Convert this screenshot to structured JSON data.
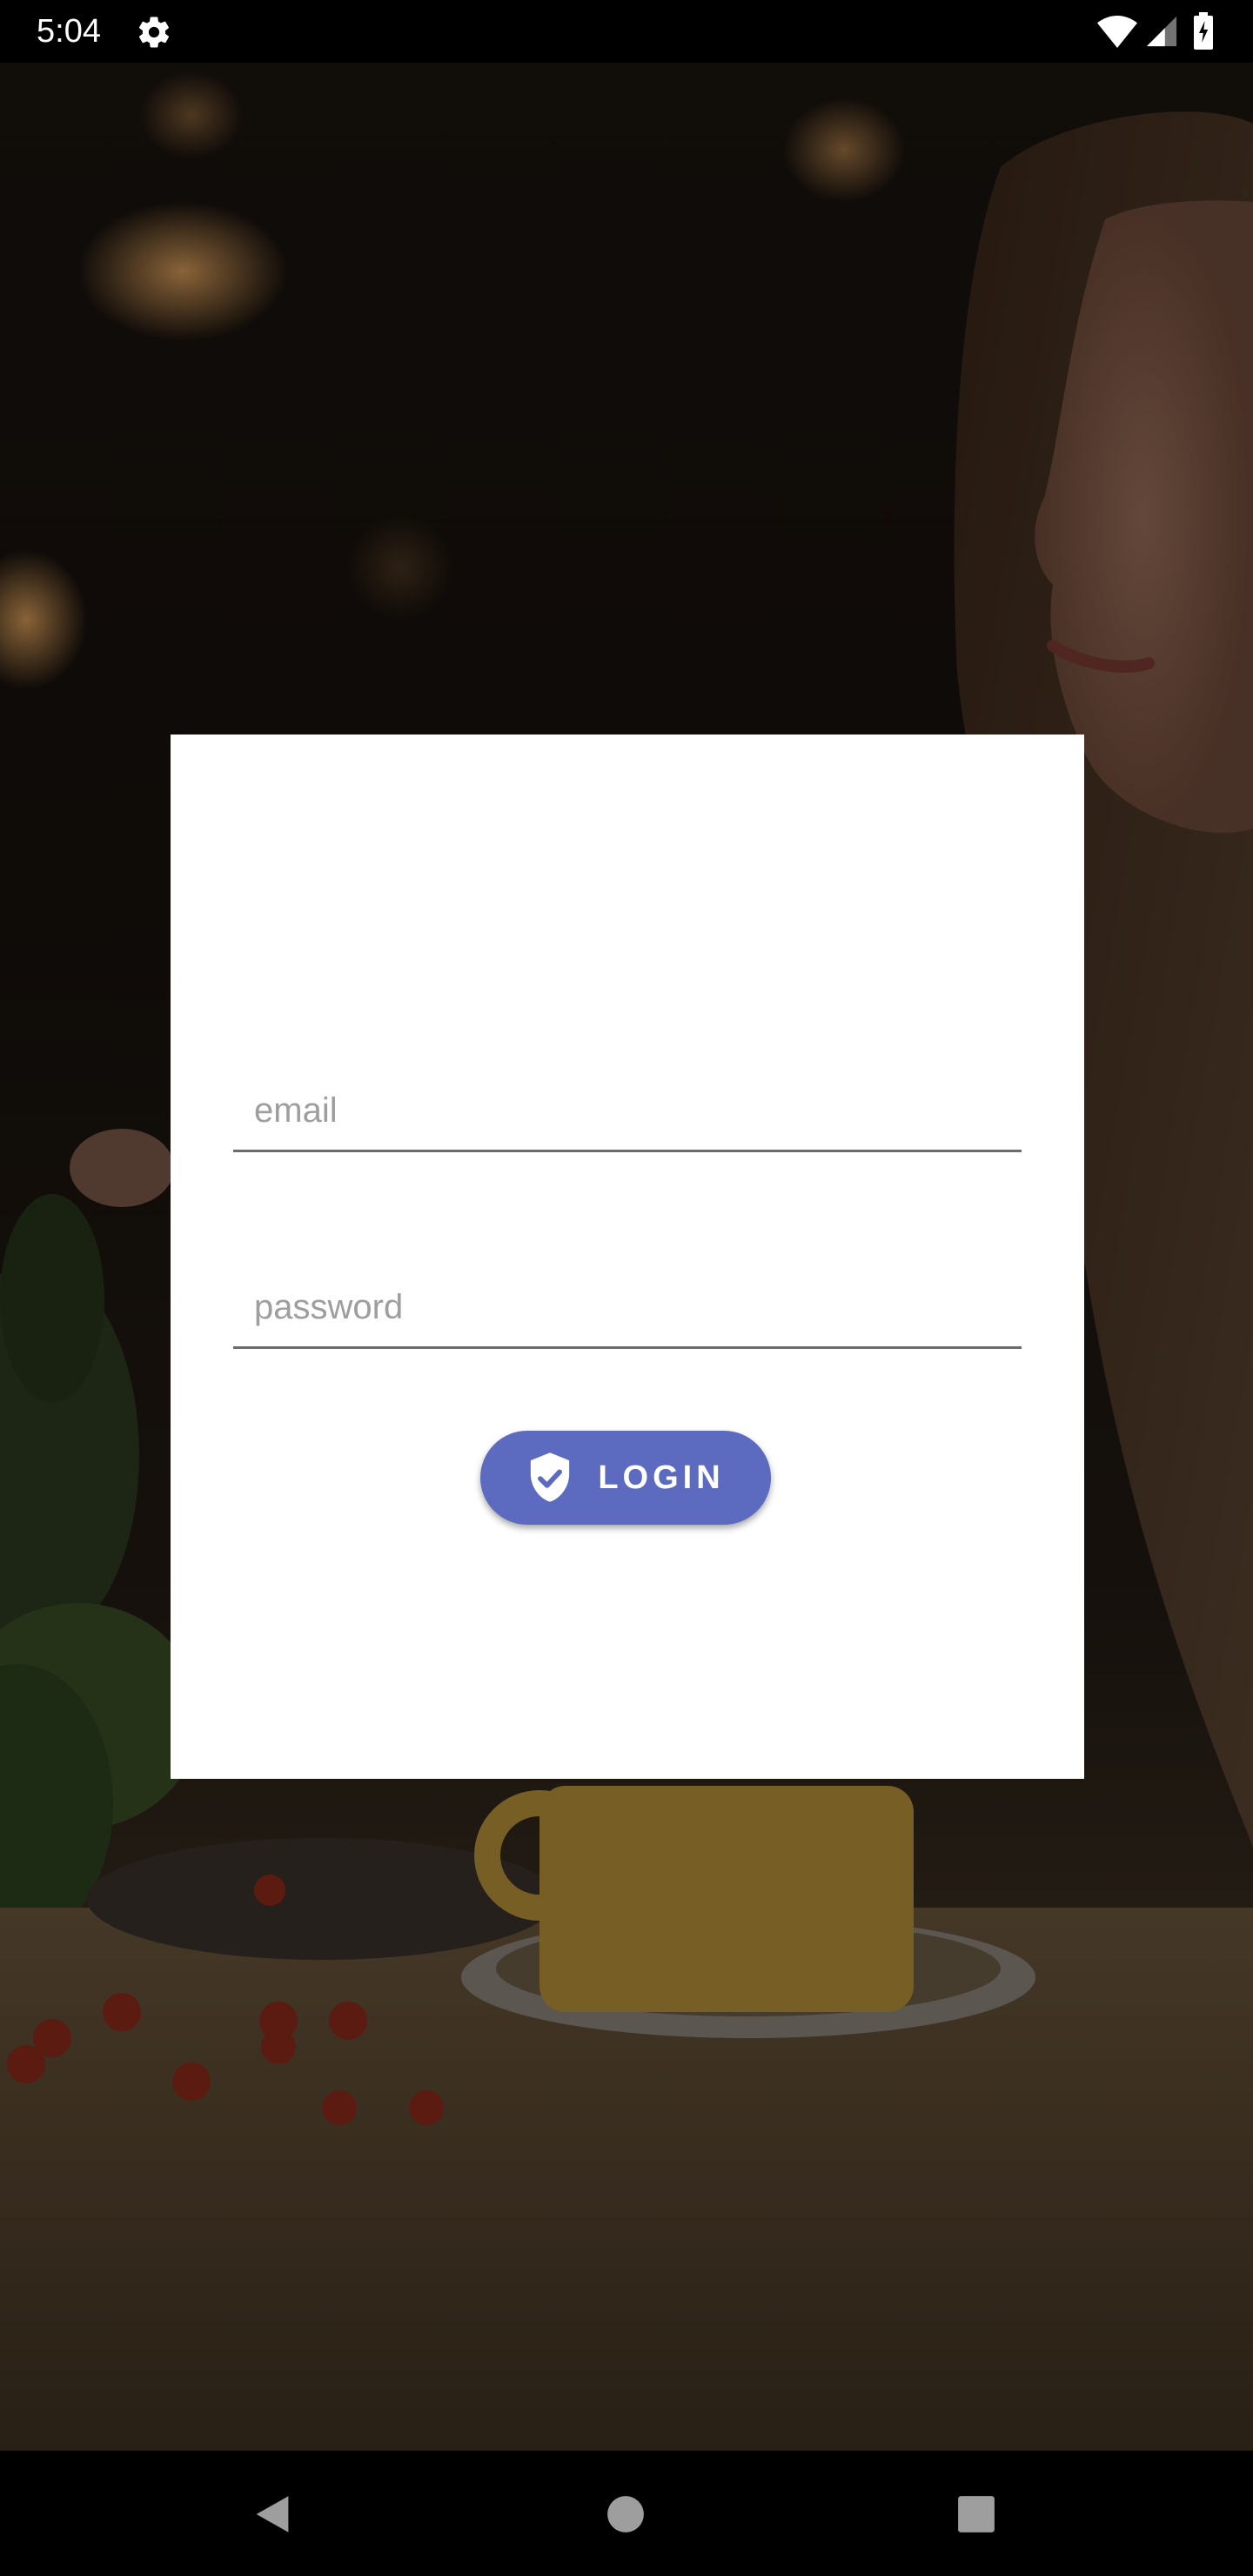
{
  "status_bar": {
    "time": "5:04",
    "icons": [
      "gear-icon",
      "wifi-icon",
      "cell-signal-icon",
      "battery-icon"
    ]
  },
  "background": {
    "description_icon": "photo-background"
  },
  "login_card": {
    "email": {
      "placeholder": "email",
      "value": ""
    },
    "password": {
      "placeholder": "password",
      "value": ""
    },
    "login_button": {
      "label": "LOGIN",
      "icon": "shield-check-icon"
    }
  },
  "nav_bar": {
    "icons": [
      "back-icon",
      "home-icon",
      "recents-icon"
    ]
  },
  "colors": {
    "accent": "#5c6bc0",
    "card": "#ffffff",
    "underline": "#6b6b6b",
    "placeholder": "#9e9e9e"
  }
}
